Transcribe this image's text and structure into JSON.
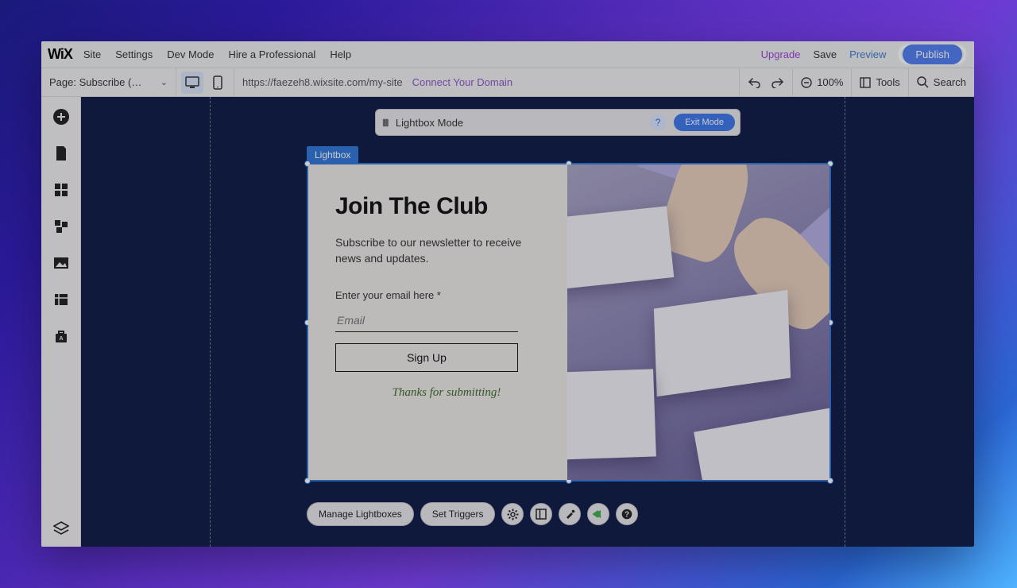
{
  "logo": "WiX",
  "menu": {
    "site": "Site",
    "settings": "Settings",
    "devmode": "Dev Mode",
    "hire": "Hire a Professional",
    "help": "Help"
  },
  "top": {
    "upgrade": "Upgrade",
    "save": "Save",
    "preview": "Preview",
    "publish": "Publish"
  },
  "toolbar": {
    "page": "Page: Subscribe (…",
    "url": "https://faezeh8.wixsite.com/my-site",
    "connect": "Connect Your Domain",
    "zoom": "100%",
    "tools": "Tools",
    "search": "Search"
  },
  "mode": {
    "label": "Lightbox Mode",
    "exit": "Exit Mode",
    "help": "?"
  },
  "selection_tag": "Lightbox",
  "form": {
    "title": "Join The Club",
    "sub": "Subscribe to our newsletter to receive news and updates.",
    "field_label": "Enter your email here *",
    "placeholder": "Email",
    "button": "Sign Up",
    "thanks": "Thanks for submitting!"
  },
  "actions": {
    "manage": "Manage Lightboxes",
    "triggers": "Set Triggers"
  }
}
